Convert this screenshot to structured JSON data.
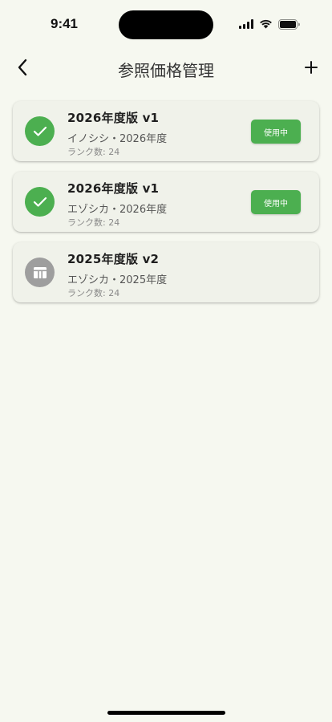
{
  "status_bar": {
    "time": "9:41"
  },
  "nav": {
    "title": "参照価格管理",
    "back_icon": "chevron-left-icon",
    "add_icon": "plus-icon"
  },
  "items": [
    {
      "title": "2026年度版 v1",
      "subtitle": "イノシシ・2026年度",
      "meta": "ランク数: 24",
      "badge": "使用中",
      "active": true,
      "icon": "check-circle-icon"
    },
    {
      "title": "2026年度版 v1",
      "subtitle": "エゾシカ・2026年度",
      "meta": "ランク数: 24",
      "badge": "使用中",
      "active": true,
      "icon": "check-circle-icon"
    },
    {
      "title": "2025年度版 v2",
      "subtitle": "エゾシカ・2025年度",
      "meta": "ランク数: 24",
      "badge": "",
      "active": false,
      "icon": "table-icon"
    }
  ],
  "colors": {
    "background": "#f6f8f0",
    "card": "#f0f2ea",
    "accent": "#4caf50",
    "inactive": "#9e9e9e"
  }
}
